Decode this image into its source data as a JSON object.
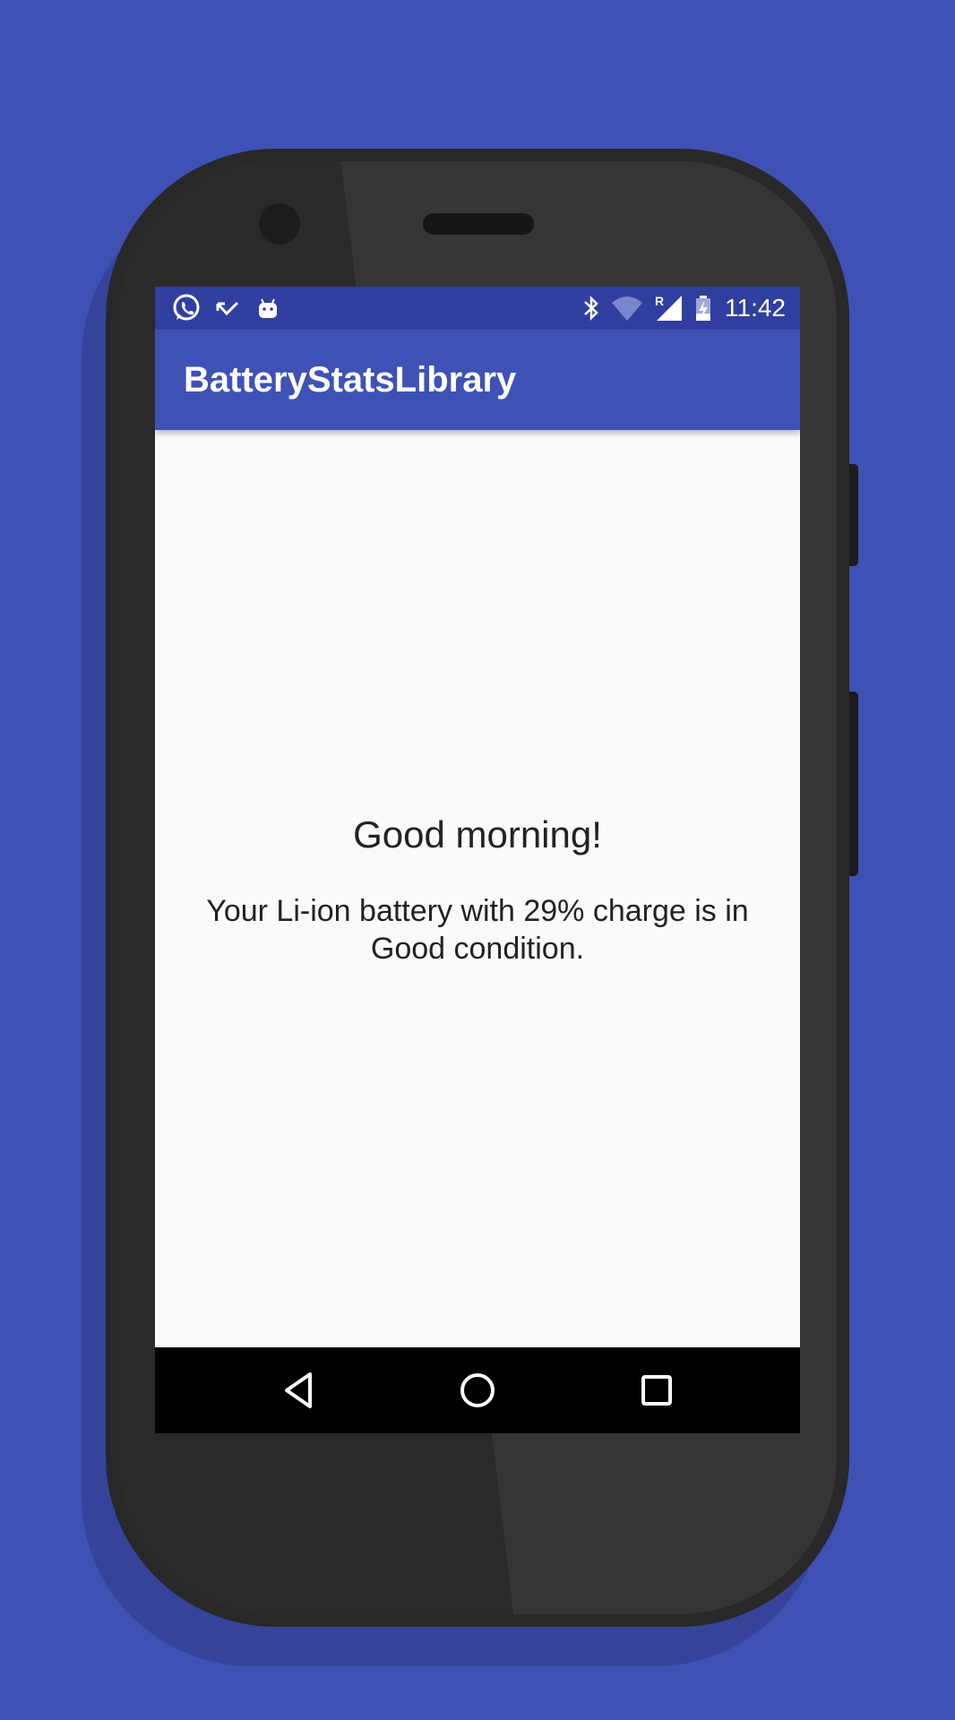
{
  "status_bar": {
    "time": "11:42",
    "left_icons": [
      "whatsapp-icon",
      "missed-call-icon",
      "android-icon"
    ],
    "right_icons": [
      "bluetooth-icon",
      "wifi-icon",
      "cell-signal-roaming-icon",
      "battery-charging-icon"
    ],
    "roaming_indicator": "R",
    "color": "#303f9f"
  },
  "app_bar": {
    "title": "BatteryStatsLibrary",
    "color": "#3f51b5"
  },
  "main": {
    "greeting": "Good morning!",
    "message": "Your Li-ion battery with 29% charge is in Good condition."
  },
  "nav_bar": {
    "buttons": [
      "back-icon",
      "home-icon",
      "recents-icon"
    ]
  },
  "colors": {
    "background": "#3f51b5",
    "content_background": "#fafafa",
    "text": "#222222"
  }
}
